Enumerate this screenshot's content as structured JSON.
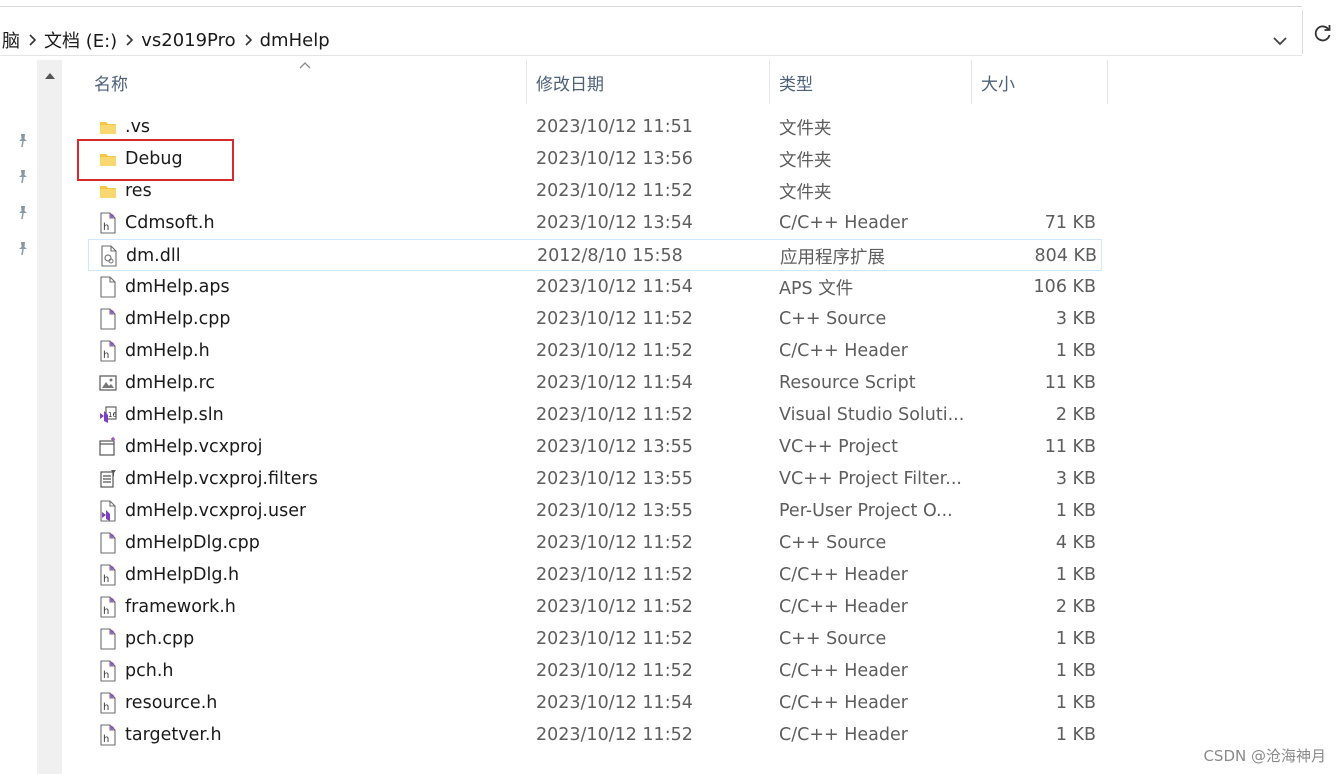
{
  "address": {
    "crumbs": [
      {
        "label": "脑"
      },
      {
        "label": "文档 (E:)"
      },
      {
        "label": "vs2019Pro"
      },
      {
        "label": "dmHelp"
      }
    ],
    "dropdown_icon": "chevron-down-icon",
    "refresh_icon": "refresh-icon"
  },
  "columns": {
    "name": "名称",
    "date": "修改日期",
    "type": "类型",
    "size": "大小"
  },
  "files": [
    {
      "name": ".vs",
      "date": "2023/10/12 11:51",
      "type": "文件夹",
      "size": "",
      "icon": "folder-icon"
    },
    {
      "name": "Debug",
      "date": "2023/10/12 13:56",
      "type": "文件夹",
      "size": "",
      "icon": "folder-icon"
    },
    {
      "name": "res",
      "date": "2023/10/12 11:52",
      "type": "文件夹",
      "size": "",
      "icon": "folder-icon"
    },
    {
      "name": "Cdmsoft.h",
      "date": "2023/10/12 13:54",
      "type": "C/C++ Header",
      "size": "71 KB",
      "icon": "header-file-icon"
    },
    {
      "name": "dm.dll",
      "date": "2012/8/10 15:58",
      "type": "应用程序扩展",
      "size": "804 KB",
      "icon": "dll-file-icon"
    },
    {
      "name": "dmHelp.aps",
      "date": "2023/10/12 11:54",
      "type": "APS 文件",
      "size": "106 KB",
      "icon": "blank-file-icon"
    },
    {
      "name": "dmHelp.cpp",
      "date": "2023/10/12 11:52",
      "type": "C++ Source",
      "size": "3 KB",
      "icon": "cpp-file-icon"
    },
    {
      "name": "dmHelp.h",
      "date": "2023/10/12 11:52",
      "type": "C/C++ Header",
      "size": "1 KB",
      "icon": "header-file-icon"
    },
    {
      "name": "dmHelp.rc",
      "date": "2023/10/12 11:54",
      "type": "Resource Script",
      "size": "11 KB",
      "icon": "resource-file-icon"
    },
    {
      "name": "dmHelp.sln",
      "date": "2023/10/12 11:52",
      "type": "Visual Studio Soluti...",
      "size": "2 KB",
      "icon": "solution-file-icon"
    },
    {
      "name": "dmHelp.vcxproj",
      "date": "2023/10/12 13:55",
      "type": "VC++ Project",
      "size": "11 KB",
      "icon": "project-file-icon"
    },
    {
      "name": "dmHelp.vcxproj.filters",
      "date": "2023/10/12 13:55",
      "type": "VC++ Project Filter...",
      "size": "3 KB",
      "icon": "filters-file-icon"
    },
    {
      "name": "dmHelp.vcxproj.user",
      "date": "2023/10/12 13:55",
      "type": "Per-User Project O...",
      "size": "1 KB",
      "icon": "user-project-file-icon"
    },
    {
      "name": "dmHelpDlg.cpp",
      "date": "2023/10/12 11:52",
      "type": "C++ Source",
      "size": "4 KB",
      "icon": "cpp-file-icon"
    },
    {
      "name": "dmHelpDlg.h",
      "date": "2023/10/12 11:52",
      "type": "C/C++ Header",
      "size": "1 KB",
      "icon": "header-file-icon"
    },
    {
      "name": "framework.h",
      "date": "2023/10/12 11:52",
      "type": "C/C++ Header",
      "size": "2 KB",
      "icon": "header-file-icon"
    },
    {
      "name": "pch.cpp",
      "date": "2023/10/12 11:52",
      "type": "C++ Source",
      "size": "1 KB",
      "icon": "cpp-file-icon"
    },
    {
      "name": "pch.h",
      "date": "2023/10/12 11:52",
      "type": "C/C++ Header",
      "size": "1 KB",
      "icon": "header-file-icon"
    },
    {
      "name": "resource.h",
      "date": "2023/10/12 11:54",
      "type": "C/C++ Header",
      "size": "1 KB",
      "icon": "header-file-icon"
    },
    {
      "name": "targetver.h",
      "date": "2023/10/12 11:52",
      "type": "C/C++ Header",
      "size": "1 KB",
      "icon": "header-file-icon"
    }
  ],
  "hovered_row": 4,
  "highlighted_row": 1,
  "colors": {
    "folder": "#f3c64a",
    "highlight": "#d42b2b",
    "hover_border": "#cde8ff",
    "header_text": "#4c607a"
  },
  "watermark": "CSDN @沧海神月"
}
